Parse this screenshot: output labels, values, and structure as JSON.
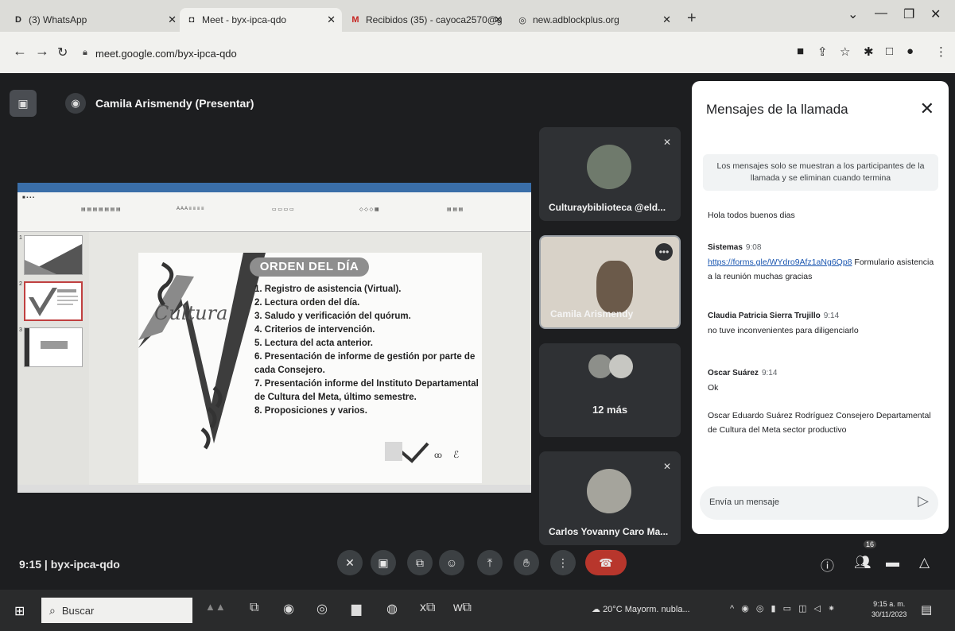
{
  "browser": {
    "tabs": [
      {
        "icon": "whatsapp-icon",
        "glyph": "D",
        "label": "(3) WhatsApp"
      },
      {
        "icon": "meet-icon",
        "glyph": "◘",
        "label": "Meet - byx-ipca-qdo"
      },
      {
        "icon": "gmail-icon",
        "glyph": "M",
        "label": "Recibidos (35) - cayoca2570@g"
      },
      {
        "icon": "adblock-icon",
        "glyph": "◎",
        "label": "new.adblockplus.org"
      }
    ],
    "url": "meet.google.com/byx-ipca-qdo"
  },
  "meet": {
    "presenter_name": "Camila Arismendy (Presentar)",
    "meeting_time": "9:15",
    "meeting_code": "byx-ipca-qdo",
    "participants_count": "16",
    "tiles": [
      {
        "name": "Culturaybiblioteca @eld..."
      },
      {
        "name": "Camila Arismendy"
      },
      {
        "name": "12 más"
      },
      {
        "name": "Carlos Yovanny Caro Ma..."
      }
    ]
  },
  "slide": {
    "title": "ORDEN DEL DÍA",
    "logo_text": "Cultura",
    "items": [
      "1. Registro de asistencia (Virtual).",
      "2. Lectura orden del día.",
      "3. Saludo y verificación del quórum.",
      "4. Criterios de intervención.",
      "5. Lectura del acta anterior.",
      "6. Presentación de informe de gestión por parte de cada Consejero.",
      "7. Presentación informe del Instituto Departamental de Cultura del Meta, último semestre.",
      "8. Proposiciones y varios."
    ]
  },
  "chat": {
    "title": "Mensajes de la llamada",
    "notice": "Los mensajes solo se muestran a los participantes de la llamada y se eliminan cuando termina",
    "messages": [
      {
        "sender": "",
        "time": "",
        "text": "Hola todos buenos dias"
      },
      {
        "sender": "Sistemas",
        "time": "9:08",
        "link": "https://forms.gle/WYdro9Afz1aNg6Qp8",
        "text": "Formulario asistencia a la reunión muchas gracias"
      },
      {
        "sender": "Claudia Patricia Sierra Trujillo",
        "time": "9:14",
        "text": "no tuve inconvenientes para diligenciarlo"
      },
      {
        "sender": "Oscar Suárez",
        "time": "9:14",
        "text": "Ok"
      },
      {
        "sender": "",
        "time": "",
        "text": "Oscar Eduardo Suárez Rodríguez Consejero Departamental de Cultura del Meta sector productivo"
      }
    ],
    "input_placeholder": "Envía un mensaje"
  },
  "taskbar": {
    "search_placeholder": "Buscar",
    "weather": "20°C  Mayorm. nubla...",
    "time": "9:15 a. m.",
    "date": "30/11/2023"
  }
}
